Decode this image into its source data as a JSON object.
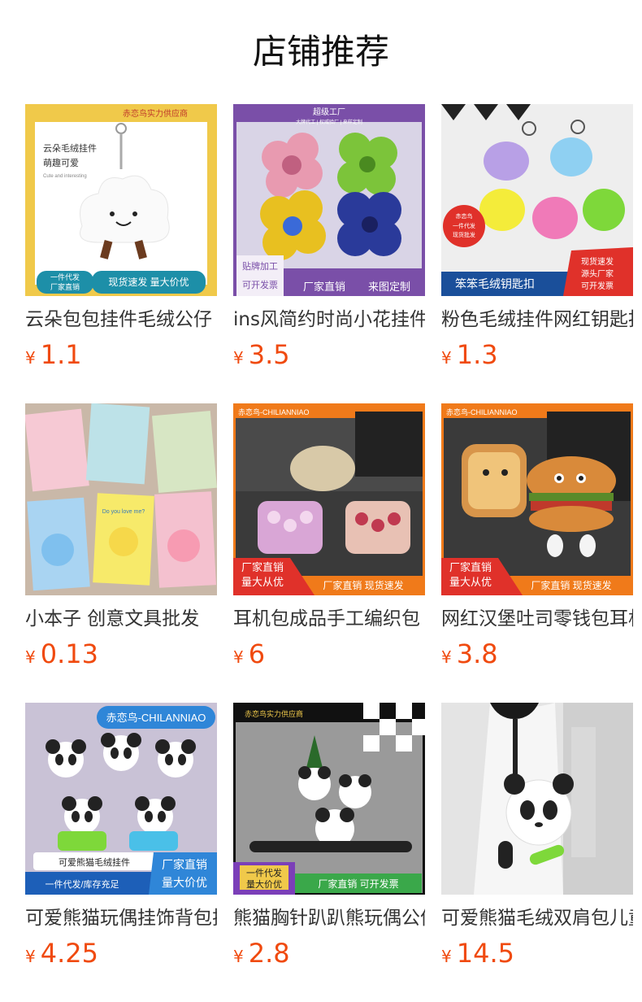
{
  "page_title": "店铺推荐",
  "currency_symbol": "¥",
  "products": [
    {
      "name": "云朵包包挂件毛绒公仔",
      "price": "1.1",
      "tags": {
        "top": "赤恋鸟实力供应商",
        "left1": "云朵毛绒挂件",
        "left2": "萌趣可爱",
        "small": "Cute and interesting",
        "b1": "一件代发",
        "b2": "厂家直销",
        "b3": "现货速发 量大价优"
      }
    },
    {
      "name": "ins风简约时尚小花挂件",
      "price": "3.5",
      "tags": {
        "top": "超级工厂",
        "sub": "大牌代工 | 权威验厂 | 来样定制",
        "b1": "贴牌加工",
        "b2": "可开发票",
        "b3": "厂家直销",
        "b4": "来图定制"
      }
    },
    {
      "name": "粉色毛绒挂件网红钥匙扣",
      "price": "1.3",
      "tags": {
        "badge1": "赤恋鸟",
        "badge2": "一件代发",
        "badge3": "现货批发",
        "bottom": "笨笨毛绒钥匙扣",
        "r1": "现货速发",
        "r2": "源头厂家",
        "r3": "可开发票"
      }
    },
    {
      "name": "小本子 创意文具批发",
      "price": "0.13",
      "tags": {
        "t1": "Do you love me?"
      }
    },
    {
      "name": "耳机包成品手工编织包",
      "price": "6",
      "tags": {
        "top": "赤恋鸟-CHILIANNIAO",
        "l1": "厂家直销",
        "l2": "量大从优",
        "r": "厂家直销 现货速发"
      }
    },
    {
      "name": "网红汉堡吐司零钱包耳机包",
      "price": "3.8",
      "tags": {
        "top": "赤恋鸟-CHILIANNIAO",
        "l1": "厂家直销",
        "l2": "量大从优",
        "r": "厂家直销 现货速发"
      }
    },
    {
      "name": "可爱熊猫玩偶挂饰背包挂件",
      "price": "4.25",
      "tags": {
        "top": "赤恋鸟-CHILANNIAO",
        "mid": "可爱熊猫毛绒挂件",
        "b": "一件代发/库存充足",
        "r1": "厂家直销",
        "r2": "量大价优"
      }
    },
    {
      "name": "熊猫胸针趴趴熊玩偶公仔",
      "price": "2.8",
      "tags": {
        "top": "赤恋鸟实力供应商",
        "l1": "一件代发",
        "l2": "量大价优",
        "r": "厂家直销 可开发票"
      }
    },
    {
      "name": "可爱熊猫毛绒双肩包儿童",
      "price": "14.5",
      "tags": {}
    }
  ]
}
